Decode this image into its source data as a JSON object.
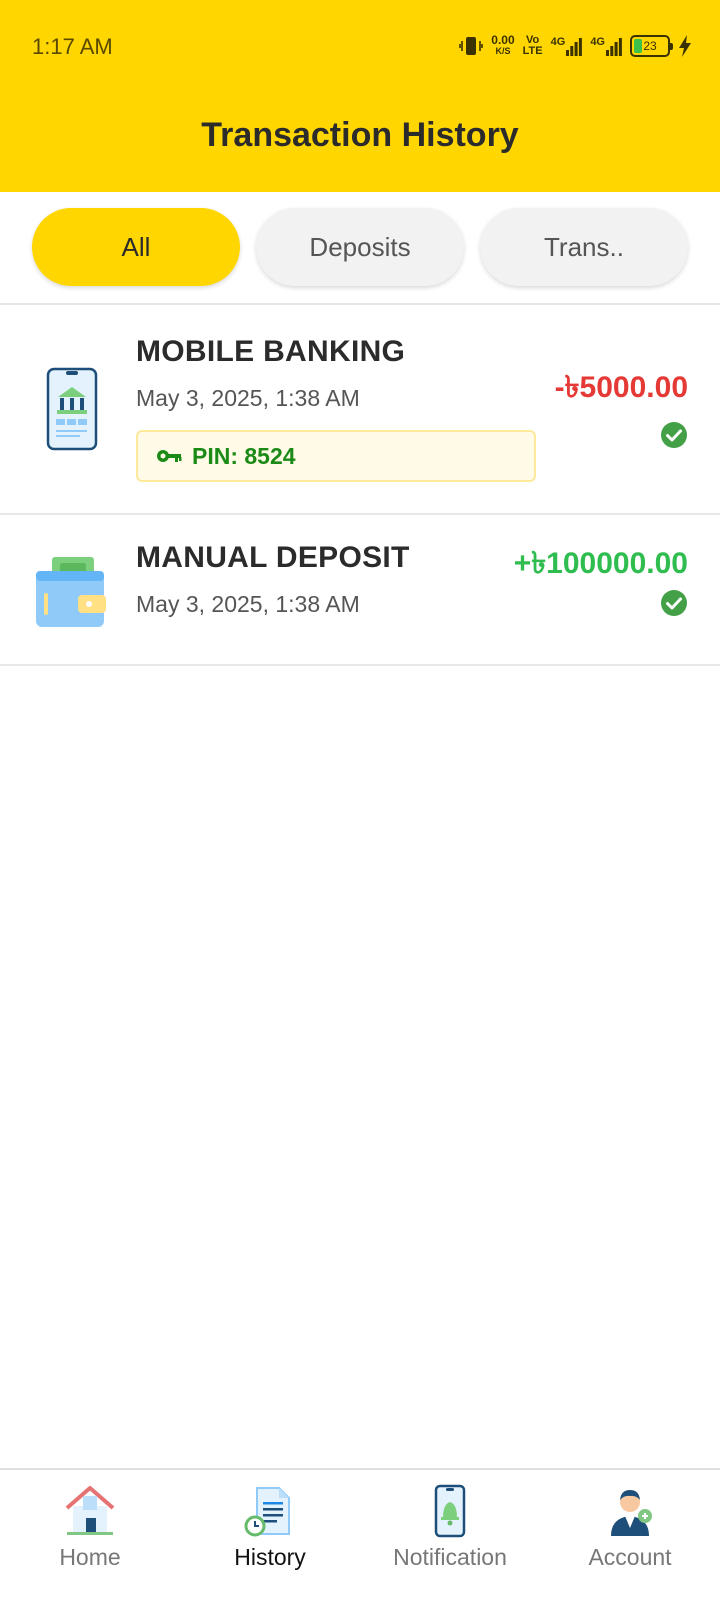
{
  "status_bar": {
    "time": "1:17 AM",
    "speed_value": "0.00",
    "speed_unit": "K/S",
    "volte_top": "Vo",
    "volte_bottom": "LTE",
    "net1": "4G",
    "net2": "4G",
    "battery": "23"
  },
  "header": {
    "title": "Transaction History"
  },
  "tabs": [
    {
      "label": "All",
      "active": true
    },
    {
      "label": "Deposits",
      "active": false
    },
    {
      "label": "Trans..",
      "active": false
    }
  ],
  "transactions": [
    {
      "title": "MOBILE BANKING",
      "date": "May 3, 2025, 1:38 AM",
      "pin": "PIN: 8524",
      "amount": "-৳5000.00",
      "status": "completed",
      "icon": "mobile-bank-icon"
    },
    {
      "title": "MANUAL DEPOSIT",
      "date": "May 3, 2025, 1:38 AM",
      "amount": "+৳100000.00",
      "status": "completed",
      "icon": "wallet-icon"
    }
  ],
  "bottom_nav": [
    {
      "label": "Home",
      "icon": "home-icon",
      "active": false
    },
    {
      "label": "History",
      "icon": "history-icon",
      "active": true
    },
    {
      "label": "Notification",
      "icon": "notification-icon",
      "active": false
    },
    {
      "label": "Account",
      "icon": "account-icon",
      "active": false
    }
  ],
  "colors": {
    "accent": "#FFD600",
    "negative": "#e53935",
    "positive": "#2ebd4e",
    "pin": "#1b8a17"
  }
}
